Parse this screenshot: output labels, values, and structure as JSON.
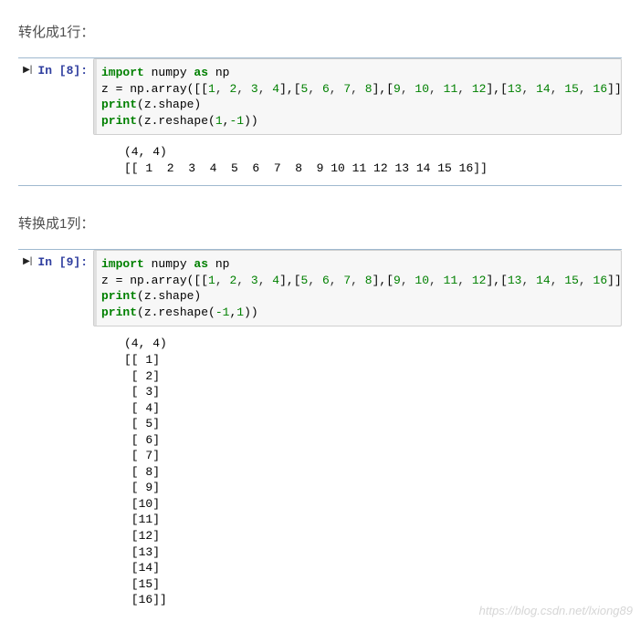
{
  "sections": {
    "sec1": {
      "title": "转化成1行："
    },
    "sec2": {
      "title": "转换成1列："
    }
  },
  "cells": {
    "c1": {
      "prompt": "In [8]:",
      "code": {
        "l1_kw1": "import",
        "l1_mod": " numpy ",
        "l1_kw2": "as",
        "l1_alias": " np",
        "l2_pre": "z = np.array([[",
        "l2_n1": "1",
        "l2_n2": "2",
        "l2_n3": "3",
        "l2_n4": "4",
        "l2_mid1": "],[",
        "l2_n5": "5",
        "l2_n6": "6",
        "l2_n7": "7",
        "l2_n8": "8",
        "l2_mid2": "],[",
        "l2_n9": "9",
        "l2_n10": "10",
        "l2_n11": "11",
        "l2_n12": "12",
        "l2_mid3": "],[",
        "l2_n13": "13",
        "l2_n14": "14",
        "l2_n15": "15",
        "l2_n16": "16",
        "l2_end": "]])",
        "l3_pre": "print",
        "l3_body": "(z.shape)",
        "l4_pre": "print",
        "l4_body_a": "(z.reshape(",
        "l4_r1": "1",
        "l4_c": ",",
        "l4_r2": "-1",
        "l4_body_b": "))"
      },
      "output": "(4, 4)\n[[ 1  2  3  4  5  6  7  8  9 10 11 12 13 14 15 16]]"
    },
    "c2": {
      "prompt": "In [9]:",
      "code": {
        "l1_kw1": "import",
        "l1_mod": " numpy ",
        "l1_kw2": "as",
        "l1_alias": " np",
        "l2_pre": "z = np.array([[",
        "l2_n1": "1",
        "l2_n2": "2",
        "l2_n3": "3",
        "l2_n4": "4",
        "l2_mid1": "],[",
        "l2_n5": "5",
        "l2_n6": "6",
        "l2_n7": "7",
        "l2_n8": "8",
        "l2_mid2": "],[",
        "l2_n9": "9",
        "l2_n10": "10",
        "l2_n11": "11",
        "l2_n12": "12",
        "l2_mid3": "],[",
        "l2_n13": "13",
        "l2_n14": "14",
        "l2_n15": "15",
        "l2_n16": "16",
        "l2_end": "]])",
        "l3_pre": "print",
        "l3_body": "(z.shape)",
        "l4_pre": "print",
        "l4_body_a": "(z.reshape(",
        "l4_r1": "-1",
        "l4_c": ",",
        "l4_r2": "1",
        "l4_body_b": "))"
      },
      "output": "(4, 4)\n[[ 1]\n [ 2]\n [ 3]\n [ 4]\n [ 5]\n [ 6]\n [ 7]\n [ 8]\n [ 9]\n [10]\n [11]\n [12]\n [13]\n [14]\n [15]\n [16]]"
    }
  },
  "watermark": "https://blog.csdn.net/lxiong89"
}
